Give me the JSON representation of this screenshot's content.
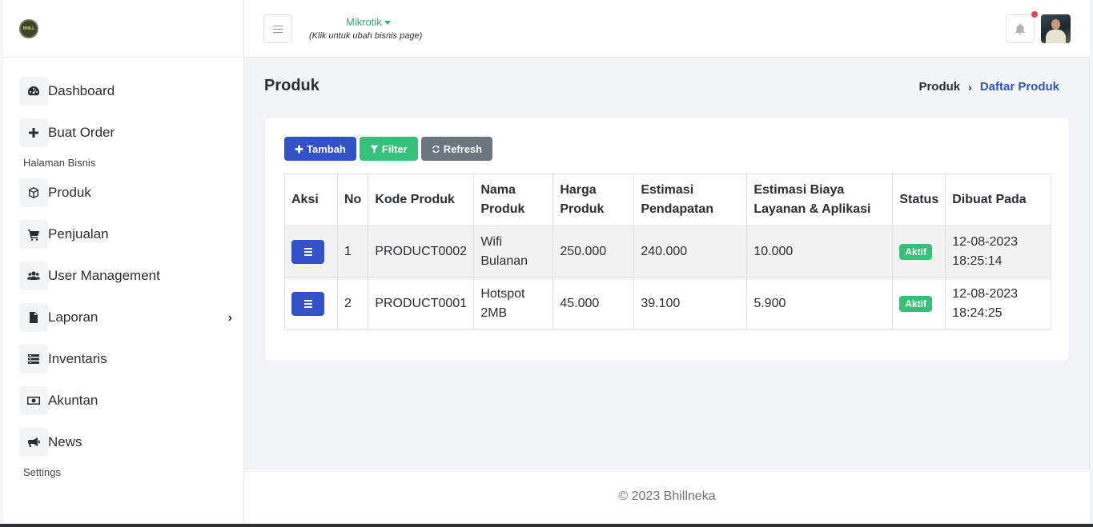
{
  "sidebar": {
    "logo_text": "BHILL",
    "items": [
      {
        "label": "Dashboard",
        "icon": "dashboard-icon"
      },
      {
        "label": "Buat Order",
        "icon": "plus-icon"
      },
      {
        "label": "Produk",
        "icon": "box-icon"
      },
      {
        "label": "Penjualan",
        "icon": "cart-icon"
      },
      {
        "label": "User Management",
        "icon": "users-icon"
      },
      {
        "label": "Laporan",
        "icon": "file-icon"
      },
      {
        "label": "Inventaris",
        "icon": "list-icon"
      },
      {
        "label": "Akuntan",
        "icon": "money-icon"
      },
      {
        "label": "News",
        "icon": "bullhorn-icon"
      }
    ],
    "sections": {
      "business": "Halaman Bisnis",
      "settings": "Settings"
    },
    "laporan_arrow": "›"
  },
  "header": {
    "business_name": "Mikrotik",
    "business_hint": "(Klik untuk ubah bisnis page)"
  },
  "page": {
    "title": "Produk",
    "breadcrumb": [
      "Produk",
      "Daftar Produk"
    ],
    "breadcrumb_sep": "›"
  },
  "toolbar": {
    "add_label": "Tambah",
    "filter_label": "Filter",
    "refresh_label": "Refresh"
  },
  "table": {
    "headers": [
      "Aksi",
      "No",
      "Kode Produk",
      "Nama Produk",
      "Harga Produk",
      "Estimasi Pendapatan",
      "Estimasi Biaya Layanan & Aplikasi",
      "Status",
      "Dibuat Pada"
    ],
    "rows": [
      {
        "no": "1",
        "kode": "PRODUCT0002",
        "nama": "Wifi Bulanan",
        "harga": "250.000",
        "pendapatan": "240.000",
        "biaya": "10.000",
        "status": "Aktif",
        "dibuat": "12-08-2023 18:25:14"
      },
      {
        "no": "2",
        "kode": "PRODUCT0001",
        "nama": "Hotspot 2MB",
        "harga": "45.000",
        "pendapatan": "39.100",
        "biaya": "5.900",
        "status": "Aktif",
        "dibuat": "12-08-2023 18:24:25"
      }
    ]
  },
  "footer": {
    "text": "© 2023 Bhillneka"
  },
  "colors": {
    "primary": "#3352c8",
    "success": "#35c17a",
    "secondary": "#6c757d",
    "link": "#3355b8"
  }
}
